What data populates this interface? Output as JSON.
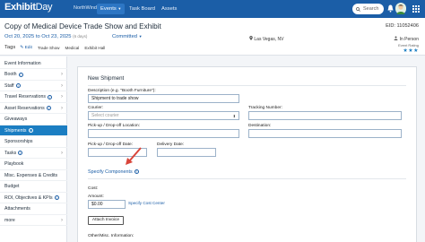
{
  "topbar": {
    "logo_main": "Exhibit",
    "logo_accent": "Day",
    "account": "NorthWind Star",
    "nav": [
      "Events",
      "Task Board",
      "Assets"
    ],
    "search_placeholder": "Search"
  },
  "header": {
    "title": "Copy of Medical Device Trade Show and Exhibit",
    "event_id": "EID: 11052406",
    "date_start": "Oct 20, 2025",
    "date_sep": "to",
    "date_end": "Oct 23, 2025",
    "date_note": "(6 days)",
    "status": "Committed",
    "location": "Las Vegas, NV",
    "format": "In Person",
    "tags_label": "Tags",
    "edit_label": "Edit",
    "tags": [
      "Trade Show",
      "Medical",
      "Exhibit Hall"
    ],
    "rating_label": "Event Rating",
    "rating_stars": "★★★"
  },
  "sidebar": {
    "items": [
      {
        "label": "Event Information",
        "chev": false,
        "info": false
      },
      {
        "label": "Booth",
        "chev": true,
        "info": true
      },
      {
        "label": "Staff",
        "chev": true,
        "info": true
      },
      {
        "label": "Travel Reservations",
        "chev": true,
        "info": true
      },
      {
        "label": "Asset Reservations",
        "chev": true,
        "info": true
      },
      {
        "label": "Giveaways",
        "chev": false,
        "info": false
      },
      {
        "label": "Shipments",
        "chev": false,
        "info": true,
        "active": true
      },
      {
        "label": "Sponsorships",
        "chev": false,
        "info": false
      },
      {
        "label": "Tasks",
        "chev": true,
        "info": true
      },
      {
        "label": "Playbook",
        "chev": false,
        "info": false
      },
      {
        "label": "Misc. Expenses & Credits",
        "chev": false,
        "info": false
      },
      {
        "label": "Budget",
        "chev": false,
        "info": false
      },
      {
        "label": "ROI, Objectives & KPIs",
        "chev": false,
        "info": true
      },
      {
        "label": "Attachments",
        "chev": false,
        "info": false
      },
      {
        "label": "more",
        "chev": true,
        "info": false
      }
    ]
  },
  "form": {
    "title": "New Shipment",
    "description_label": "Description (e.g. \"Booth Furniture\"):",
    "description_value": "Shipment to trade show",
    "courier_label": "Courier:",
    "courier_placeholder": "Select courier",
    "tracking_label": "Tracking Number:",
    "pickup_location_label": "Pick-up / Drop-off Location:",
    "destination_label": "Destination:",
    "pickup_date_label": "Pick-up / Drop-off Date:",
    "delivery_date_label": "Delivery Date:",
    "components_label": "Specify Components",
    "cost_label": "Cost:",
    "amount_label": "Amount:",
    "amount_value": "$0.00",
    "cost_center_link": "Specify Cost Center",
    "attach_invoice_label": "Attach Invoice",
    "other_label": "Other/Misc. Information:"
  },
  "colors": {
    "brand": "#1b5ea7",
    "active": "#1b7ec2",
    "pointer": "#d9453a"
  }
}
